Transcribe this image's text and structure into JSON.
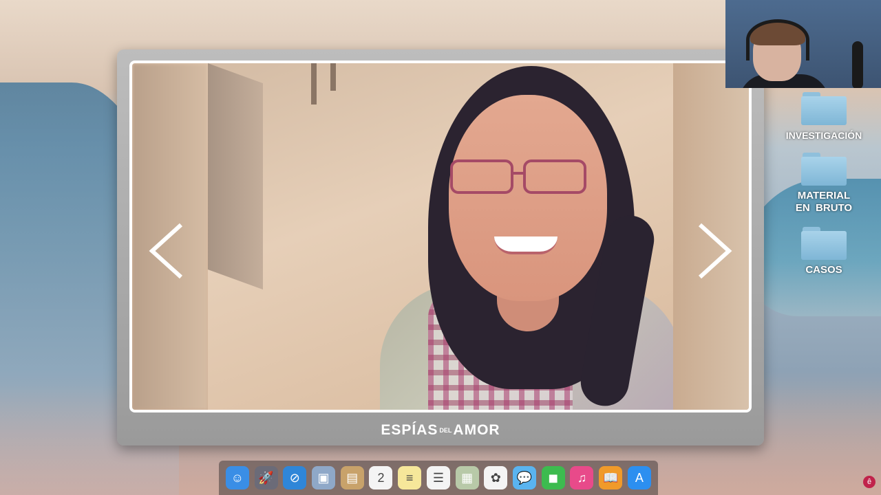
{
  "gallery": {
    "brand_part1": "ESPÍAS",
    "brand_small": "DEL",
    "brand_part2": "AMOR",
    "prev_icon": "chevron-left-icon",
    "next_icon": "chevron-right-icon"
  },
  "desktop": {
    "folders": [
      {
        "label": "INVESTIGACIÓN"
      },
      {
        "label_line1": "MATERIAL",
        "label_line2": "EN  BRUTO"
      },
      {
        "label": "CASOS"
      }
    ]
  },
  "dock": {
    "items": [
      {
        "name": "finder-icon",
        "color": "#3a8ee6",
        "glyph": "☺"
      },
      {
        "name": "launchpad-icon",
        "color": "#6b6b78",
        "glyph": "🚀"
      },
      {
        "name": "safari-icon",
        "color": "#2f86d8",
        "glyph": "⊘"
      },
      {
        "name": "preview-icon",
        "color": "#8fa8c8",
        "glyph": "▣"
      },
      {
        "name": "contacts-icon",
        "color": "#c8a26a",
        "glyph": "▤"
      },
      {
        "name": "calendar-icon",
        "color": "#f4f4f4",
        "glyph": "2"
      },
      {
        "name": "notes-icon",
        "color": "#f6e79a",
        "glyph": "≡"
      },
      {
        "name": "reminders-icon",
        "color": "#f4f4f4",
        "glyph": "☰"
      },
      {
        "name": "photo-booth-icon",
        "color": "#b8c9a8",
        "glyph": "▦"
      },
      {
        "name": "photos-icon",
        "color": "#f4f4f4",
        "glyph": "✿"
      },
      {
        "name": "messages-icon",
        "color": "#5ab4f0",
        "glyph": "💬"
      },
      {
        "name": "facetime-icon",
        "color": "#3dbb4f",
        "glyph": "◼"
      },
      {
        "name": "itunes-icon",
        "color": "#e84a8a",
        "glyph": "♫"
      },
      {
        "name": "ibooks-icon",
        "color": "#f09a2a",
        "glyph": "📖"
      },
      {
        "name": "app-store-icon",
        "color": "#2c8ff0",
        "glyph": "A"
      }
    ]
  },
  "watermark_icon": "channel-logo-icon"
}
